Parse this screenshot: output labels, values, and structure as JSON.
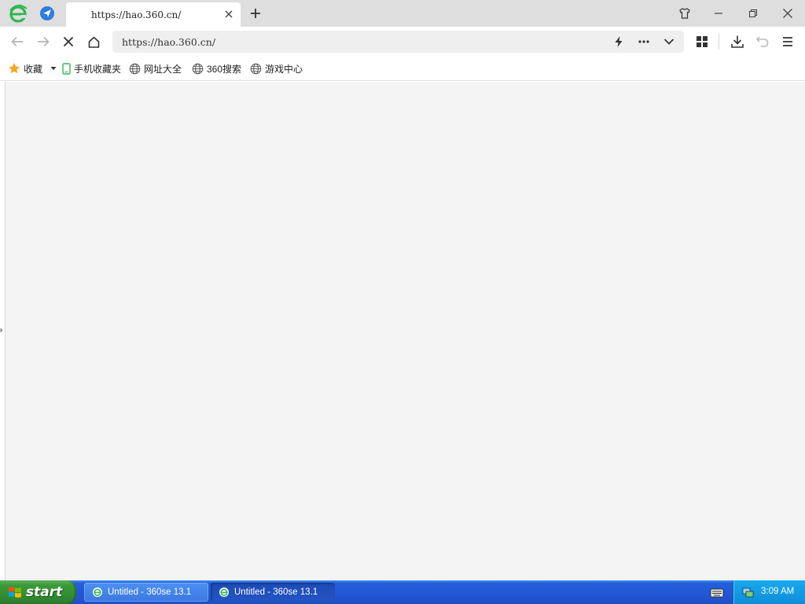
{
  "browser": {
    "tab": {
      "title": "https://hao.360.cn/"
    },
    "address_bar": {
      "url": "https://hao.360.cn/"
    },
    "icons": {
      "app_logo": "360se-logo-icon",
      "nav": "navigation-arrow-icon",
      "close_tab": "close-icon",
      "new_tab": "plus-icon",
      "skin": "shirt-icon",
      "minimize": "minimize-icon",
      "restore": "restore-icon",
      "close_window": "close-icon",
      "back": "arrow-left-icon",
      "forward": "arrow-right-icon",
      "stop": "stop-x-icon",
      "home": "home-icon",
      "speed": "lightning-icon",
      "more": "ellipsis-icon",
      "dropdown": "chevron-down-icon",
      "apps": "grid-icon",
      "download": "download-icon",
      "undo": "undo-icon",
      "menu": "hamburger-icon"
    },
    "bookmarks": [
      {
        "label": "收藏",
        "icon": "star-icon"
      },
      {
        "label": "手机收藏夹",
        "icon": "phone-icon"
      },
      {
        "label": "网址大全",
        "icon": "globe-icon"
      },
      {
        "label": "360搜索",
        "icon": "globe-icon"
      },
      {
        "label": "游戏中心",
        "icon": "globe-icon"
      }
    ]
  },
  "taskbar": {
    "start_label": "start",
    "tasks": [
      {
        "label": "Untitled - 360se 13.1",
        "active": false
      },
      {
        "label": "Untitled - 360se 13.1",
        "active": true
      }
    ],
    "clock": "3:09 AM"
  },
  "colors": {
    "logo_green": "#2fb84d",
    "taskbar_blue": "#245edb",
    "start_green": "#3c9a3a",
    "tray_blue": "#0f8ed9",
    "star_orange": "#f5a623"
  }
}
